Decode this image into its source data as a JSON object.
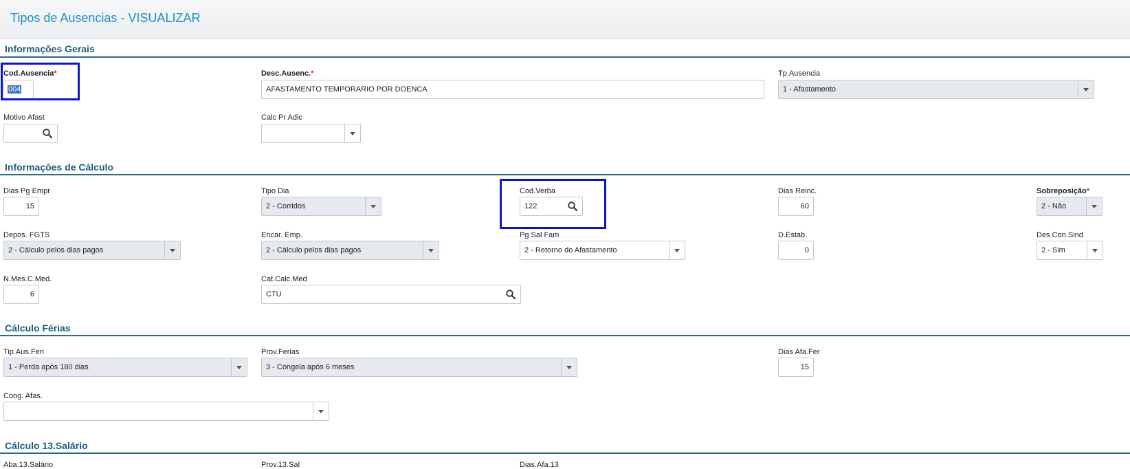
{
  "page": {
    "title": "Tipos de Ausencias - VISUALIZAR"
  },
  "sections": {
    "gerais": "Informações Gerais",
    "calculo": "Informações de Cálculo",
    "ferias": "Cálculo Férias",
    "salario13": "Cálculo 13.Salário"
  },
  "gerais": {
    "cod_ausencia": {
      "label": "Cod.Ausencia",
      "value": "004"
    },
    "desc_ausenc": {
      "label": "Desc.Ausenc.",
      "value": "AFASTAMENTO TEMPORARIO POR DOENCA"
    },
    "tp_ausencia": {
      "label": "Tp.Ausencia",
      "value": "1 - Afastamento"
    },
    "motivo_afast": {
      "label": "Motivo Afast",
      "value": ""
    },
    "calc_pr_adic": {
      "label": "Calc Pr Adic",
      "value": ""
    }
  },
  "calculo": {
    "dias_pg_empr": {
      "label": "Dias Pg Empr",
      "value": "15"
    },
    "tipo_dia": {
      "label": "Tipo Dia",
      "value": "2 - Corridos"
    },
    "cod_verba": {
      "label": "Cod.Verba",
      "value": "122"
    },
    "dias_reinc": {
      "label": "Dias Reinc.",
      "value": "60"
    },
    "sobreposicao": {
      "label": "Sobreposição",
      "value": "2 - Não"
    },
    "depos_fgts": {
      "label": "Depos. FGTS",
      "value": "2 - Cálculo pelos dias pagos"
    },
    "encar_emp": {
      "label": "Encar. Emp.",
      "value": "2 - Cálculo pelos dias pagos"
    },
    "pg_sal_fam": {
      "label": "Pg Sal Fam",
      "value": "2 - Retorno do Afastamento"
    },
    "d_estab": {
      "label": "D.Estab.",
      "value": "0"
    },
    "des_con_sind": {
      "label": "Des.Con.Sind",
      "value": "2 - Sim"
    },
    "n_mes_c_med": {
      "label": "N.Mes.C.Med.",
      "value": "6"
    },
    "cat_calc_med": {
      "label": "Cat.Calc.Med",
      "value": "CTU"
    }
  },
  "ferias": {
    "tip_aus_feri": {
      "label": "Tip.Aus.Feri",
      "value": "1 - Perda após 180 dias"
    },
    "prov_ferias": {
      "label": "Prov.Ferias",
      "value": "3 - Congela após 6 meses"
    },
    "dias_afa_fer": {
      "label": "Dias Afa.Fer",
      "value": "15"
    },
    "cong_afas": {
      "label": "Cong. Afas.",
      "value": ""
    }
  },
  "salario13": {
    "label1": "Aba.13.Salário",
    "label2": "Prov.13.Sal",
    "label3": "Dias.Afa.13"
  },
  "required_mark": "*",
  "colors": {
    "accent": "#1f8fc2",
    "section": "#1d5c7d",
    "highlight": "#0a14c8"
  },
  "icons": {
    "lookup": "magnifier-icon",
    "dropdown": "chevron-down-icon"
  }
}
